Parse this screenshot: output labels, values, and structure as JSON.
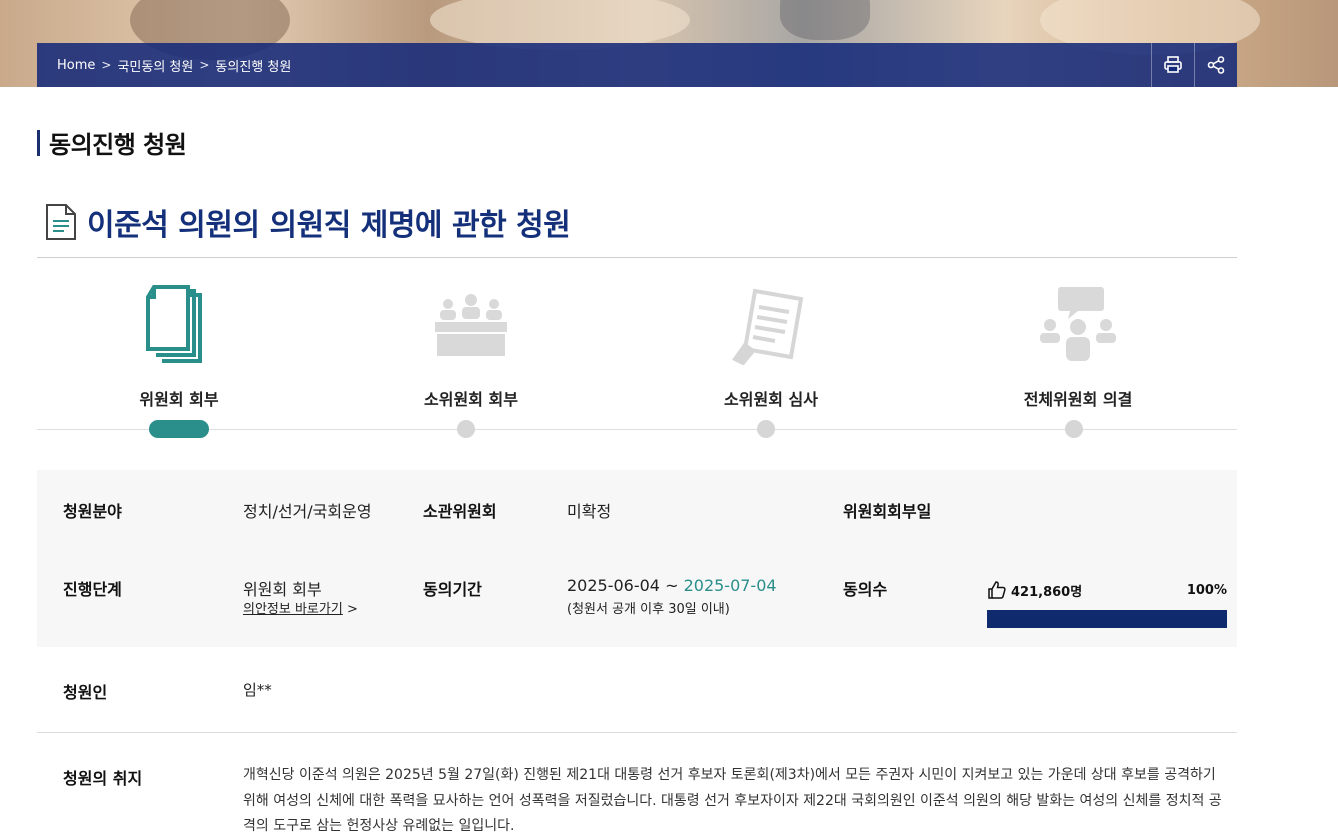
{
  "breadcrumb": {
    "home": "Home",
    "level1": "국민동의 청원",
    "level2": "동의진행 청원"
  },
  "page": {
    "heading": "동의진행 청원",
    "petition_title": "이준석 의원의 의원직 제명에 관한 청원"
  },
  "steps": [
    {
      "label": "위원회 회부",
      "icon": "documents-icon",
      "active": true
    },
    {
      "label": "소위원회 회부",
      "icon": "meeting-table-icon",
      "active": false
    },
    {
      "label": "소위원회 심사",
      "icon": "review-document-icon",
      "active": false
    },
    {
      "label": "전체위원회 의결",
      "icon": "group-discussion-icon",
      "active": false
    }
  ],
  "info": {
    "field_label": "청원분야",
    "field_value": "정치/선거/국회운영",
    "committee_label": "소관위원회",
    "committee_value": "미확정",
    "referral_date_label": "위원회회부일",
    "referral_date_value": "",
    "stage_label": "진행단계",
    "stage_value": "위원회 회부",
    "bill_link": "의안정보 바로가기",
    "period_label": "동의기간",
    "period_start": "2025-06-04",
    "period_sep": "~",
    "period_end": "2025-07-04",
    "period_note": "(청원서 공개 이후 30일 이내)",
    "agree_label": "동의수",
    "agree_count": "421,860명",
    "agree_percent_label": "100%",
    "agree_percent_value": 100
  },
  "petitioner": {
    "label": "청원인",
    "value": "임**"
  },
  "purpose": {
    "label": "청원의 취지",
    "text": "개혁신당 이준석 의원은 2025년 5월 27일(화) 진행된 제21대 대통령 선거 후보자 토론회(제3차)에서 모든 주권자 시민이 지켜보고 있는 가운데 상대 후보를 공격하기 위해 여성의 신체에 대한 폭력을 묘사하는 언어 성폭력을 저질렀습니다. 대통령 선거 후보자이자 제22대 국회의원인 이준석 의원의 해당 발화는 여성의 신체를 정치적 공격의 도구로 삼는 헌정사상 유례없는 일입니다."
  },
  "colors": {
    "brand_navy": "#14307a",
    "accent_teal": "#2a8e8b",
    "bar_fill": "#0f2a6d"
  }
}
